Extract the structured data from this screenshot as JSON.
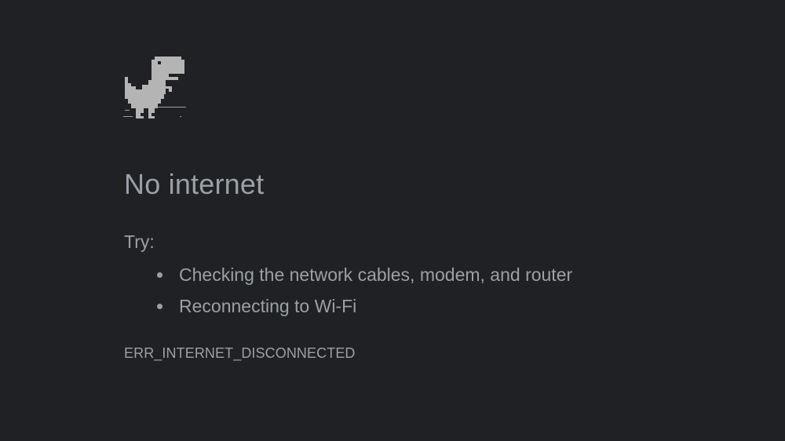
{
  "page": {
    "title": "No internet",
    "try_label": "Try:",
    "suggestions": [
      "Checking the network cables, modem, and router",
      "Reconnecting to Wi-Fi"
    ],
    "error_code": "ERR_INTERNET_DISCONNECTED"
  },
  "icons": {
    "dino": "offline-dinosaur-icon"
  },
  "colors": {
    "background": "#202124",
    "text": "#9aa0a6",
    "dino": "#b4b4b4"
  }
}
